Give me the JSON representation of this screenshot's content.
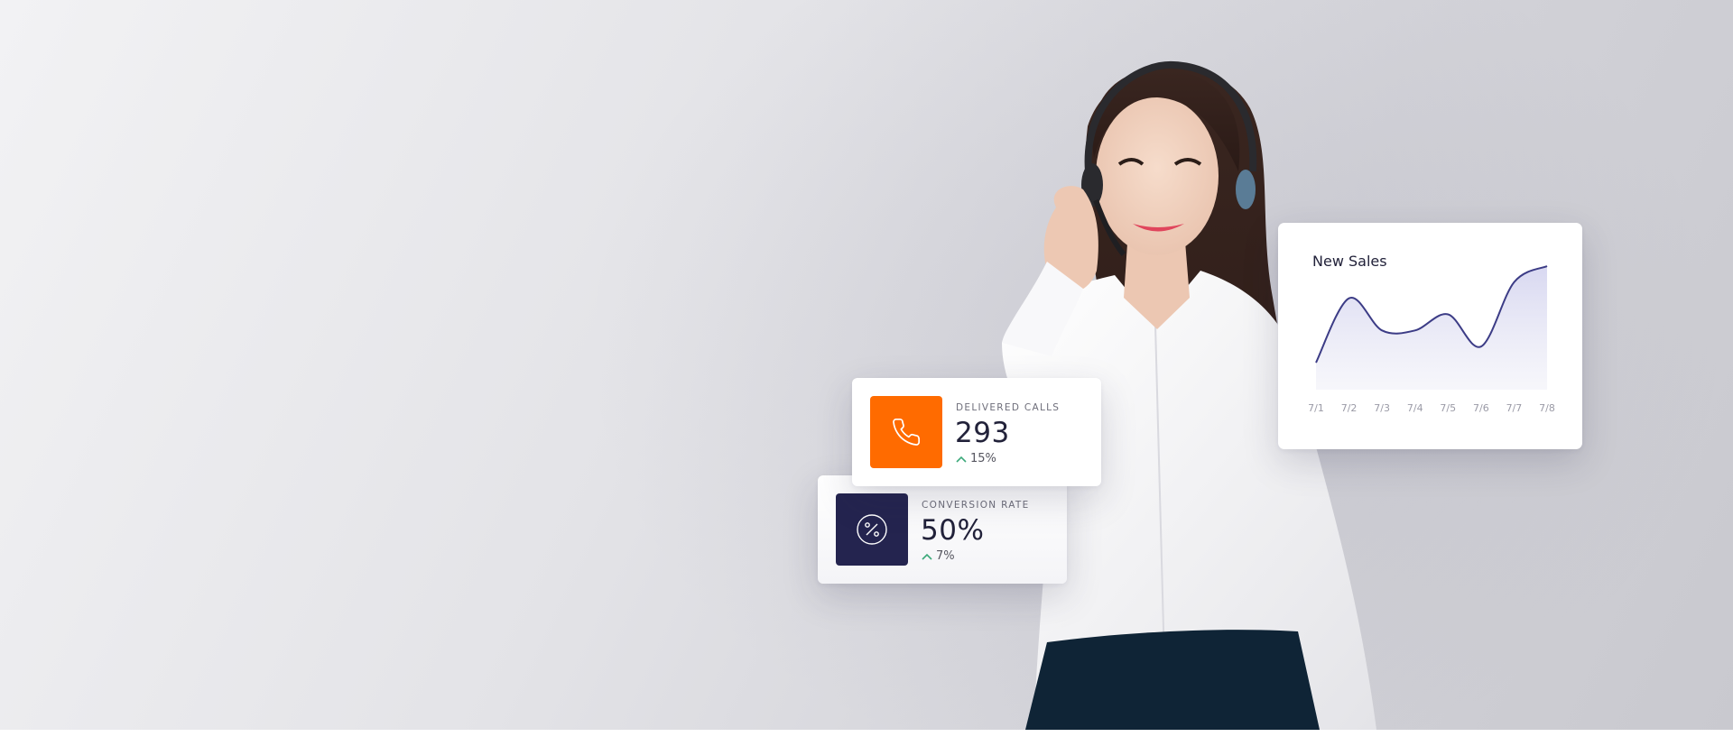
{
  "stats": {
    "delivered_calls": {
      "label": "DELIVERED CALLS",
      "value": "293",
      "change": "15%",
      "icon": "phone-icon",
      "tile_color": "#ff6b00"
    },
    "conversion_rate": {
      "label": "CONVERSION RATE",
      "value": "50%",
      "change": "7%",
      "icon": "percent-icon",
      "tile_color": "#24244f"
    },
    "change_icon": "chevron-up-icon",
    "change_color": "#3ba97a"
  },
  "chart_data": {
    "type": "area",
    "title": "New Sales",
    "categories": [
      "7/1",
      "7/2",
      "7/3",
      "7/4",
      "7/5",
      "7/6",
      "7/7",
      "7/8"
    ],
    "series": [
      {
        "values": [
          1,
          5,
          3,
          3,
          4,
          2,
          6,
          7
        ]
      }
    ],
    "line_color": "#3c3c86",
    "grid": false
  }
}
